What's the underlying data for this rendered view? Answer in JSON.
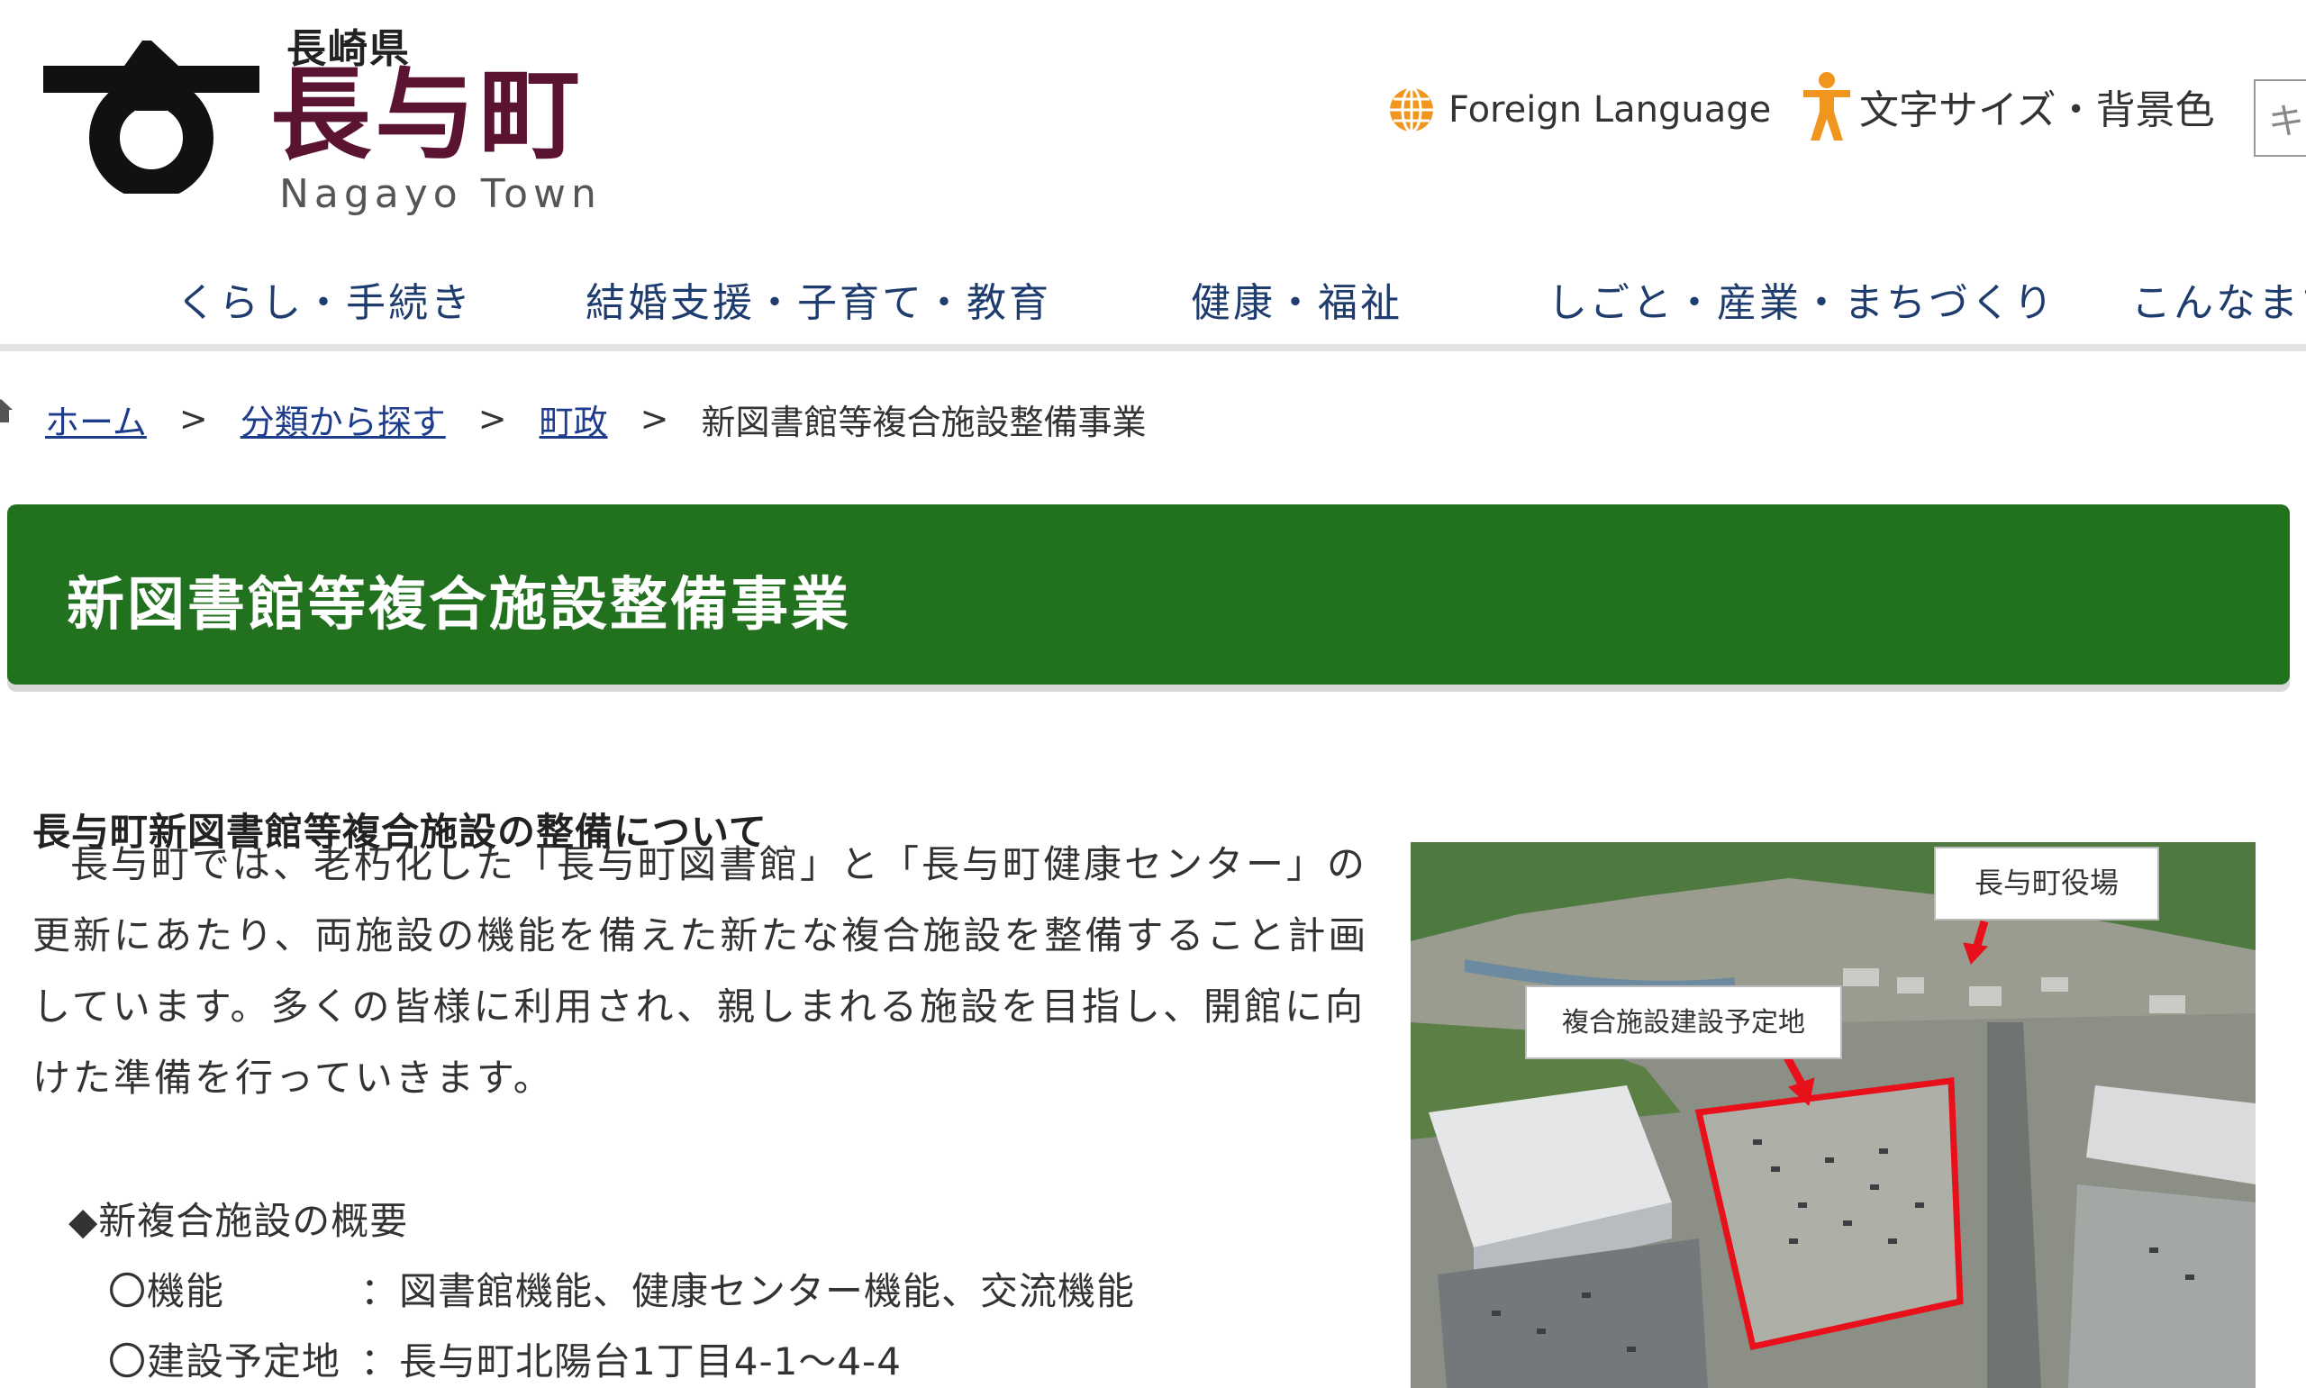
{
  "header": {
    "logo": {
      "prefecture": "長崎県",
      "town_name": "長与町",
      "town_roman": "Nagayo Town"
    },
    "foreign_language": "Foreign Language",
    "text_size_bg": "文字サイズ・背景色",
    "search_placeholder": "キ"
  },
  "nav": {
    "items": [
      "くらし・手続き",
      "結婚支援・子育て・教育",
      "健康・福祉",
      "しごと・産業・まちづくり",
      "こんなまち"
    ]
  },
  "breadcrumb": {
    "home": "ホーム",
    "sep": ">",
    "level1": "分類から探す",
    "level2": "町政",
    "current": "新図書館等複合施設整備事業"
  },
  "page": {
    "title": "新図書館等複合施設整備事業",
    "section_heading": "長与町新図書館等複合施設の整備について",
    "intro": "長与町では、老朽化した「長与町図書館」と「長与町健康センター」の更新にあたり、両施設の機能を備えた新たな複合施設を整備すること計画しています。多くの皆様に利用され、親しまれる施設を目指し、開館に向けた準備を行っていきます。",
    "overview_title": "◆新複合施設の概要",
    "details": [
      {
        "label": "〇機能",
        "value": "：図書館機能、健康センター機能、交流機能"
      },
      {
        "label": "〇建設予定地",
        "value": "：長与町北陽台1丁目4-1～4-4"
      }
    ]
  },
  "photo": {
    "label_town_office": "長与町役場",
    "label_site": "複合施設建設予定地"
  },
  "colors": {
    "title_band": "#22711f",
    "logo_text": "#5a1432",
    "nav_text": "#1e3c6e",
    "link": "#1e3c8c",
    "accent_orange": "#f0961e",
    "site_outline": "#e8101a"
  },
  "icons": {
    "logo_mark": "town-emblem-icon",
    "globe": "globe-icon",
    "person": "accessibility-person-icon",
    "home": "home-icon"
  }
}
